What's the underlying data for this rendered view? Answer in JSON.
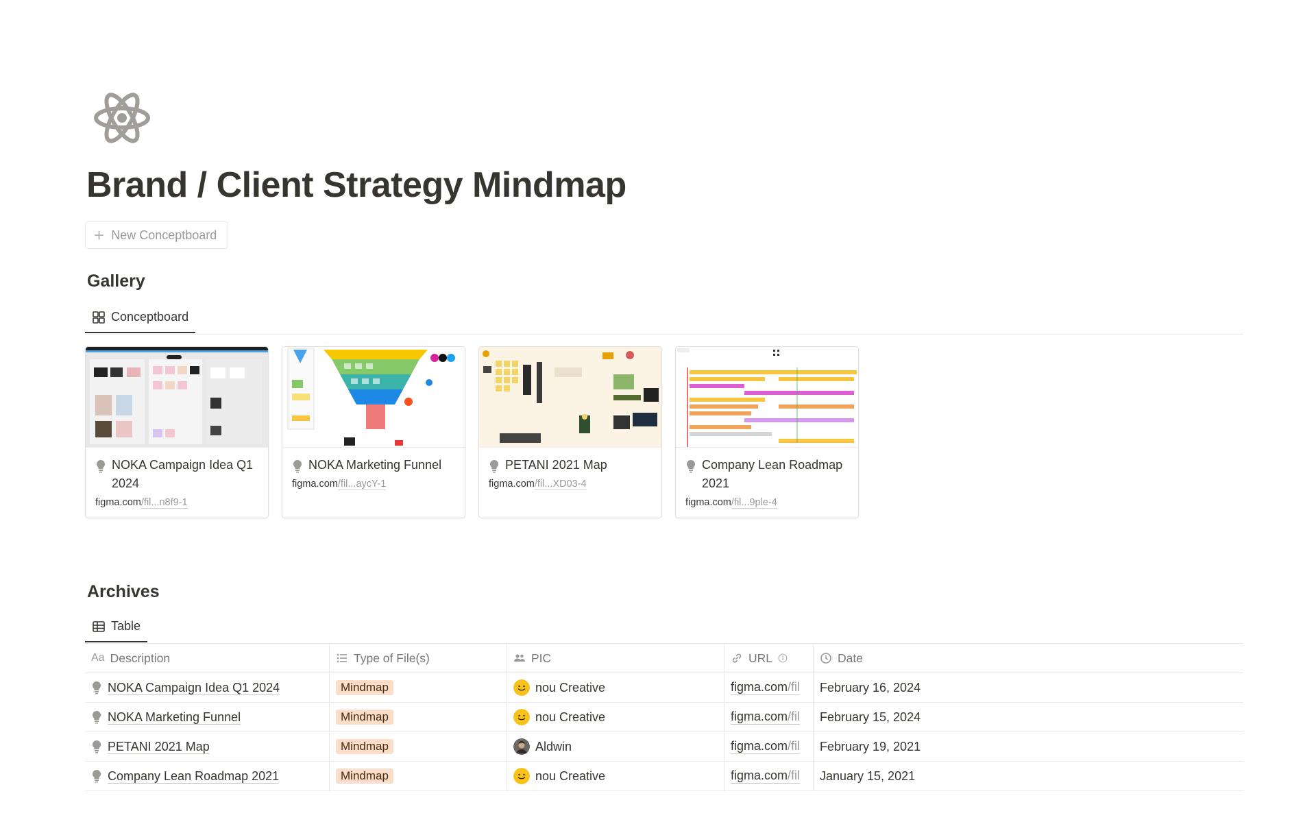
{
  "page": {
    "icon": "atom-icon",
    "title": "Brand / Client Strategy Mindmap",
    "new_button_label": "New Conceptboard"
  },
  "gallery": {
    "title": "Gallery",
    "view_label": "Conceptboard",
    "cards": [
      {
        "title": "NOKA Campaign Idea Q1 2024",
        "url_domain": "figma.com",
        "url_rest": "/fil...n8f9-1"
      },
      {
        "title": "NOKA Marketing Funnel",
        "url_domain": "figma.com",
        "url_rest": "/fil...aycY-1"
      },
      {
        "title": "PETANI 2021 Map",
        "url_domain": "figma.com",
        "url_rest": "/fil...XD03-4"
      },
      {
        "title": "Company Lean Roadmap 2021",
        "url_domain": "figma.com",
        "url_rest": "/fil...9ple-4"
      }
    ]
  },
  "archives": {
    "title": "Archives",
    "view_label": "Table",
    "columns": {
      "description": "Description",
      "type": "Type of File(s)",
      "pic": "PIC",
      "url": "URL",
      "date": "Date"
    },
    "rows": [
      {
        "description": "NOKA Campaign Idea Q1 2024",
        "type": "Mindmap",
        "pic": "nou Creative",
        "url_domain": "figma.com",
        "url_rest": "/fil",
        "date": "February 16, 2024"
      },
      {
        "description": "NOKA Marketing Funnel",
        "type": "Mindmap",
        "pic": "nou Creative",
        "url_domain": "figma.com",
        "url_rest": "/fil",
        "date": "February 15, 2024"
      },
      {
        "description": "PETANI 2021 Map",
        "type": "Mindmap",
        "pic": "Aldwin",
        "url_domain": "figma.com",
        "url_rest": "/fil",
        "date": "February 19, 2021"
      },
      {
        "description": "Company Lean Roadmap 2021",
        "type": "Mindmap",
        "pic": "nou Creative",
        "url_domain": "figma.com",
        "url_rest": "/fil",
        "date": "January 15, 2021"
      }
    ]
  },
  "colors": {
    "text": "#37352f",
    "muted": "#9b9a97",
    "tag_bg": "#fadec9",
    "tag_text": "#49290e",
    "border": "#e9e9e7"
  }
}
